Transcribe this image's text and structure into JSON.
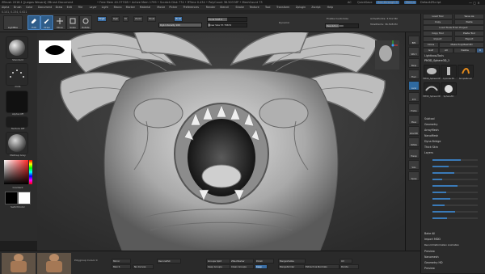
{
  "titlebar": {
    "app": "ZBrush 2018.1 [Juegos Wesard]  ZBrush Document",
    "stats": "• Free Mem 40.377GB • Active Mem 1799 • Scratch Disk 774 • RTime 0.434 • PolyCount 36.503 MP • MeshCount 73",
    "ac": "AC",
    "quicksave": "QuickSave",
    "see_through": "See-through 0",
    "menus": "Menus",
    "default_script": "DefaultZScript"
  },
  "menubar": {
    "items": [
      "Alpha",
      "Brush",
      "Color",
      "Document",
      "Draw",
      "Edit",
      "File",
      "Layer",
      "Light",
      "Macro",
      "Marker",
      "Material",
      "Movie",
      "Picker",
      "Preferences",
      "Render",
      "Stencil",
      "Stroke",
      "Texture",
      "Tool",
      "Transform",
      "Zplugin",
      "Zscript",
      "Help"
    ]
  },
  "statline": {
    "text": "0.101, 0.234, 0.621"
  },
  "topshelf": {
    "tools": [
      {
        "label": "LightBox"
      },
      {
        "label": "Edit"
      },
      {
        "label": "Draw"
      },
      {
        "label": "Move"
      },
      {
        "label": "Scale"
      },
      {
        "label": "Rotate"
      }
    ],
    "mrgb": "Mrgb",
    "rgb": "Rgb",
    "m": "M",
    "zadd": "Zadd",
    "zsub": "Zsub",
    "zcut": "Zcut",
    "rgb_intensity": "Rgb Intensity 100",
    "z_intensity": "Z Intensity 18",
    "focal_shift": "Focal Shift 0",
    "draw_size": "Draw Size 57.79674",
    "dynamic": "Dynamic",
    "enable_customize": "Enable Customize",
    "resolution": "Resolution 400",
    "active_points": "ActivePoints: 3.512 Mil",
    "total_points": "TotalPoints: 36.508 Mil"
  },
  "leftshelf": {
    "brush": "Standard",
    "stroke": "Dots",
    "alpha": "Alpha Off",
    "texture": "Texture Off",
    "material": "MatCap Gray",
    "switch_color": "SwitchColor",
    "gradient": "Gradient",
    "swatch_colors": [
      "#000000",
      "#ffffff"
    ]
  },
  "navicons": [
    {
      "label": "BPR",
      "active": false
    },
    {
      "label": "SPix 3",
      "active": false
    },
    {
      "label": "Persp",
      "active": false
    },
    {
      "label": "Floor",
      "active": false
    },
    {
      "label": "Local",
      "active": true
    },
    {
      "label": "XYZ",
      "active": false
    },
    {
      "label": "Frame",
      "active": false
    },
    {
      "label": "Move",
      "active": false
    },
    {
      "label": "Zoom3D",
      "active": false
    },
    {
      "label": "Rotate",
      "active": false
    },
    {
      "label": "Transp",
      "active": false
    },
    {
      "label": "Solo",
      "active": false
    },
    {
      "label": "Xpose",
      "active": false
    }
  ],
  "rightpanel": {
    "buttons": [
      [
        "Load Tool",
        "Save As"
      ],
      [
        "Copy",
        "Paste"
      ],
      [
        "Load Tools From Project"
      ],
      [
        "Copy Tool",
        "Paste Tool"
      ],
      [
        "Import",
        "Export"
      ],
      [
        "Clone",
        "Make PolyMesh3D"
      ],
      [
        "GoZ",
        "All",
        "Visible",
        "R"
      ]
    ],
    "lightbox_tools": "Lightbox▸Tools",
    "tool_name": "PM3D_Sphere3D_1",
    "subtools": [
      {
        "label": "PM3D_Sphere3D"
      },
      {
        "label": "Cylinder3D"
      },
      {
        "label": "SimpleBrush"
      },
      {
        "label": "PM3D_Sphere3D"
      },
      {
        "label": "Sphere3D"
      }
    ],
    "sections": [
      "Subtool",
      "Geometry",
      "ArrayMesh",
      "NanoMesh",
      "Dyna Bridge",
      "Thick Skin",
      "Layers"
    ],
    "layer_values": [
      0.62,
      0.35,
      0.48,
      0.22,
      0.55,
      0.3,
      0.4,
      0.27,
      0.5,
      0.33
    ],
    "bottom_sections": [
      "Bake All",
      "Import MDD",
      "Record Deformation Animation",
      "Preview",
      "Nanomesh",
      "Geometry HD",
      "Preview"
    ]
  },
  "bottombar": {
    "polygroup_label": "Polygroup Cursor 0",
    "mirror": "Mirror",
    "max_s": "Max S",
    "frame": "ReconstSC",
    "no_curves": "No Curves",
    "groups_split": "Groups Split",
    "zre_mesher": "ZRe-Mesher",
    "keep_groups": "Keep Groups",
    "clean_groups": "Clean Groups",
    "polish": "Polish",
    "merge_visible": "MergeVisible",
    "keep": "Keep",
    "merge_similar": "MergeSimilar",
    "extract_normals": "Extract As Normals",
    "uv": "UV",
    "divide": "Divide"
  },
  "colors": {
    "accent": "#3a6ea5",
    "panel": "#2b2b2b",
    "viewport": "#3b3b3b",
    "model": "#cfcfcf"
  }
}
